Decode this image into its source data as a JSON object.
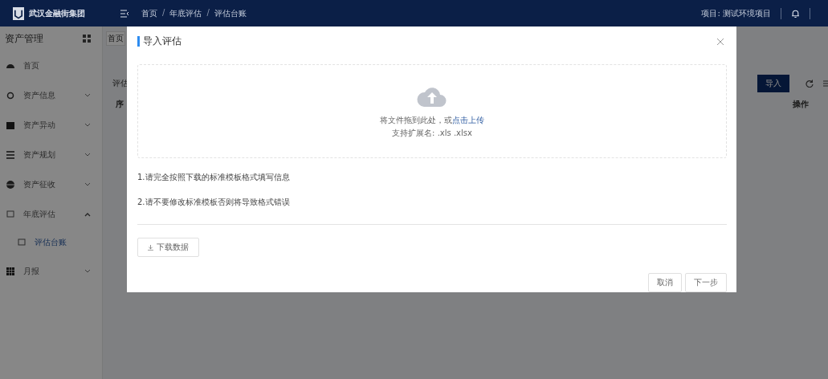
{
  "header": {
    "logo_text": "武汉金融街集团",
    "breadcrumb": [
      "首页",
      "年底评估",
      "评估台账"
    ],
    "separator": "/",
    "project_label": "项目:",
    "project_name": "测试环境项目"
  },
  "sidebar": {
    "title": "资产管理",
    "items": [
      {
        "label": "首页",
        "expandable": false,
        "selected": false
      },
      {
        "label": "资产信息",
        "expandable": true,
        "expanded": false,
        "selected": false
      },
      {
        "label": "资产异动",
        "expandable": true,
        "expanded": false,
        "selected": false
      },
      {
        "label": "资产规划",
        "expandable": true,
        "expanded": false,
        "selected": false
      },
      {
        "label": "资产征收",
        "expandable": true,
        "expanded": false,
        "selected": false
      },
      {
        "label": "年底评估",
        "expandable": true,
        "expanded": true,
        "selected": false,
        "children": [
          {
            "label": "评估台账",
            "selected": true
          }
        ]
      },
      {
        "label": "月报",
        "expandable": true,
        "expanded": false,
        "selected": false
      }
    ]
  },
  "page": {
    "tab": "首页",
    "section_title": "评估",
    "import_button": "导入",
    "first_column": "序",
    "last_column": "操作"
  },
  "modal": {
    "title": "导入评估",
    "upload_hint": "将文件拖到此处，或",
    "upload_link": "点击上传",
    "formats": "支持扩展名: .xls .xlsx",
    "notes": [
      "1.请完全按照下载的标准模板格式填写信息",
      "2.请不要修改标准模板否则将导致格式错误"
    ],
    "download_button": "下载数据",
    "buttons": [
      {
        "label": "取消"
      },
      {
        "label": "下一步"
      }
    ]
  }
}
